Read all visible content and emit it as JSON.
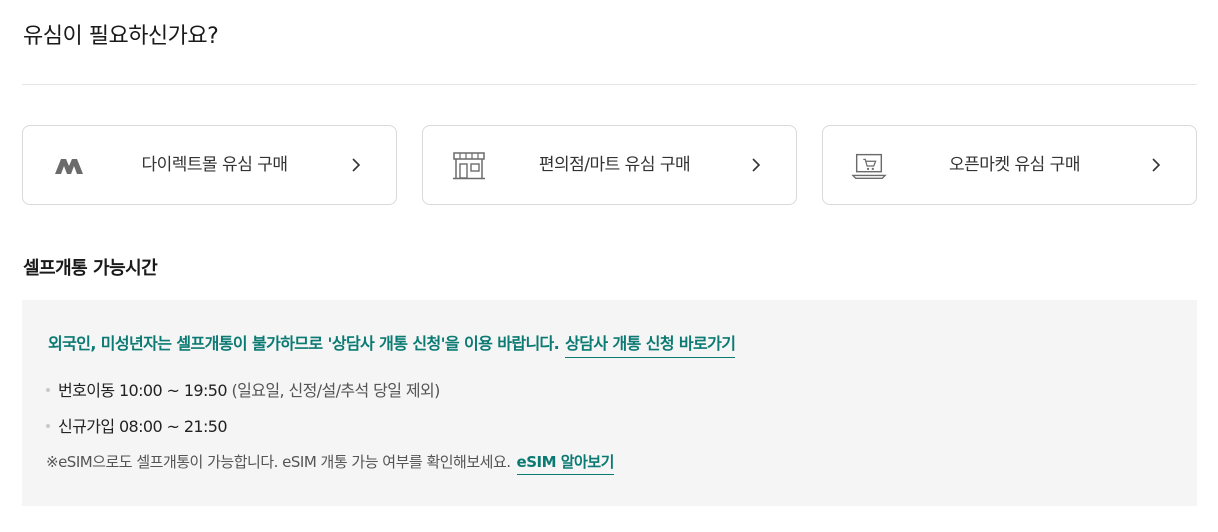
{
  "page": {
    "title": "유심이 필요하신가요?"
  },
  "cards": [
    {
      "label": "다이렉트몰 유심 구매",
      "icon": "m-logo-icon"
    },
    {
      "label": "편의점/마트 유심 구매",
      "icon": "store-icon"
    },
    {
      "label": "오픈마켓 유심 구매",
      "icon": "laptop-cart-icon"
    }
  ],
  "section": {
    "title": "셀프개통 가능시간"
  },
  "info": {
    "notice_text": "외국인, 미성년자는 셀프개통이 불가하므로 '상담사 개통 신청'을 이용 바랍니다.",
    "notice_link": "상담사 개통 신청 바로가기",
    "port_label": "번호이동 10:00 ~ 19:50",
    "port_note": "(일요일, 신정/설/추석 당일 제외)",
    "new_label": "신규가입 08:00 ~ 21:50",
    "esim_text": "※eSIM으로도 셀프개통이 가능합니다. eSIM 개통 가능 여부를 확인해보세요.",
    "esim_link": "eSIM 알아보기"
  },
  "colors": {
    "accent": "#0b7a73",
    "box_bg": "#f5f5f5",
    "border": "#d9d9d9",
    "icon_gray": "#6b6b6b"
  }
}
